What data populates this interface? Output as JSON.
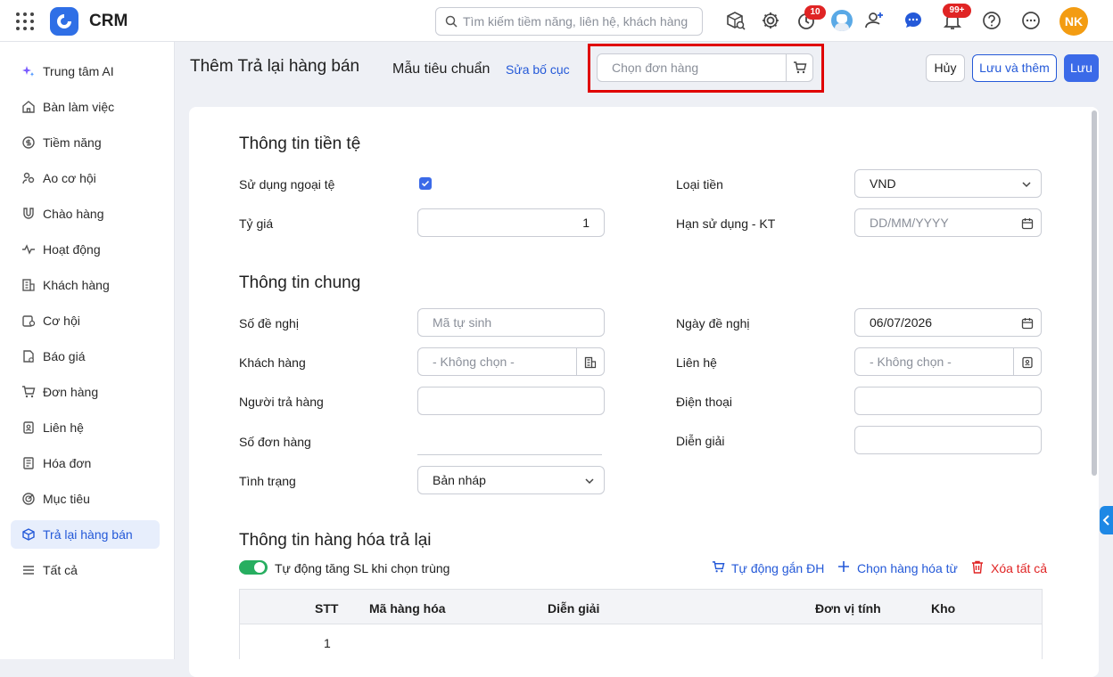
{
  "app": {
    "name": "CRM"
  },
  "search": {
    "placeholder": "Tìm kiếm tiềm năng, liên hệ, khách hàng"
  },
  "topbar": {
    "timer_badge": "10",
    "notification_badge": "99+",
    "avatar_initials": "NK"
  },
  "sidebar": {
    "items": [
      {
        "label": "Trung tâm AI",
        "icon": "sparkle-icon"
      },
      {
        "label": "Bàn làm việc",
        "icon": "home-icon"
      },
      {
        "label": "Tiềm năng",
        "icon": "coin-icon"
      },
      {
        "label": "Ao cơ hội",
        "icon": "users-icon"
      },
      {
        "label": "Chào hàng",
        "icon": "magnet-icon"
      },
      {
        "label": "Hoạt động",
        "icon": "pulse-icon"
      },
      {
        "label": "Khách hàng",
        "icon": "building-icon"
      },
      {
        "label": "Cơ hội",
        "icon": "opportunity-icon"
      },
      {
        "label": "Báo giá",
        "icon": "quote-icon"
      },
      {
        "label": "Đơn hàng",
        "icon": "cart-icon"
      },
      {
        "label": "Liên hệ",
        "icon": "contact-icon"
      },
      {
        "label": "Hóa đơn",
        "icon": "invoice-icon"
      },
      {
        "label": "Mục tiêu",
        "icon": "target-icon"
      },
      {
        "label": "Trả lại hàng bán",
        "icon": "return-box-icon",
        "active": true
      },
      {
        "label": "Tất cả",
        "icon": "menu-icon"
      }
    ]
  },
  "header": {
    "title": "Thêm Trả lại hàng bán",
    "template": "Mẫu tiêu chuẩn",
    "edit_layout": "Sửa bố cục",
    "order_placeholder": "Chọn đơn hàng",
    "cancel": "Hủy",
    "save_and_add": "Lưu và thêm",
    "save": "Lưu"
  },
  "currency": {
    "title": "Thông tin tiền tệ",
    "use_foreign_label": "Sử dụng ngoại tệ",
    "use_foreign_checked": true,
    "rate_label": "Tỷ giá",
    "rate_value": "1",
    "currency_label": "Loại tiền",
    "currency_value": "VND",
    "expiry_label": "Hạn sử dụng - KT",
    "expiry_placeholder": "DD/MM/YYYY"
  },
  "general": {
    "title": "Thông tin chung",
    "request_no_label": "Số đề nghị",
    "request_no_placeholder": "Mã tự sinh",
    "customer_label": "Khách hàng",
    "customer_placeholder": "- Không chọn -",
    "returner_label": "Người trả hàng",
    "order_no_label": "Số đơn hàng",
    "status_label": "Tình trạng",
    "status_value": "Bản nháp",
    "request_date_label": "Ngày đề nghị",
    "request_date_value": "06/07/2026",
    "contact_label": "Liên hệ",
    "contact_placeholder": "- Không chọn -",
    "phone_label": "Điện thoại",
    "description_label": "Diễn giải"
  },
  "goods": {
    "title": "Thông tin hàng hóa trả lại",
    "auto_increase_label": "Tự động tăng SL khi chọn trùng",
    "auto_increase_on": true,
    "auto_attach": "Tự động gắn ĐH",
    "choose_goods": "Chọn hàng hóa từ",
    "delete_all": "Xóa tất cả",
    "columns": [
      "STT",
      "Mã hàng hóa",
      "Diễn giải",
      "Đơn vị tính",
      "Kho"
    ],
    "rows": [
      {
        "stt": "1"
      }
    ]
  },
  "colors": {
    "accent": "#3b6ae8",
    "danger": "#e02424",
    "toggle": "#27ae60",
    "highlight": "#e00000"
  }
}
